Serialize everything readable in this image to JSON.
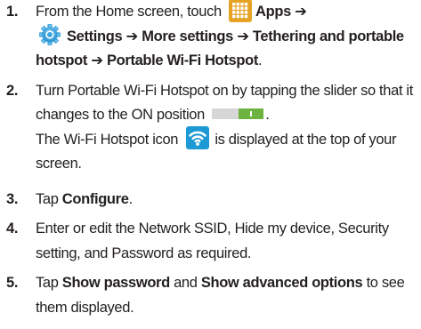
{
  "steps": [
    {
      "number": "1.",
      "line1_pre": "From the Home screen, touch",
      "apps": "Apps",
      "arrow": "➔",
      "settings": "Settings",
      "more_settings": "More settings",
      "tethering": "Tethering and portable",
      "hotspot": "hotspot",
      "portable_hotspot": "Portable Wi-Fi Hotspot",
      "period": "."
    },
    {
      "number": "2.",
      "text1": "Turn Portable Wi-Fi Hotspot on by tapping the slider so that it changes to the ON position",
      "text1_end": ".",
      "text2_pre": "The Wi-Fi Hotspot icon",
      "text2_post": "is displayed at the top of your screen."
    },
    {
      "number": "3.",
      "pre": "Tap",
      "bold": "Configure",
      "post": "."
    },
    {
      "number": "4.",
      "text": "Enter or edit the Network SSID, Hide my device, Security setting, and Password as required."
    },
    {
      "number": "5.",
      "pre": "Tap",
      "bold1": "Show password",
      "mid": "and",
      "bold2": "Show advanced options",
      "post": "to see them displayed."
    }
  ],
  "icons": {
    "apps": "apps-grid-icon",
    "settings": "settings-gear-icon",
    "slider": "on-off-slider-icon",
    "wifi": "wifi-hotspot-icon"
  },
  "colors": {
    "apps_icon": "#e5a223",
    "settings_icon": "#1d8fd0",
    "slider_on": "#6db33f",
    "slider_off": "#d6d6d6",
    "wifi_icon": "#1d9ad6"
  }
}
